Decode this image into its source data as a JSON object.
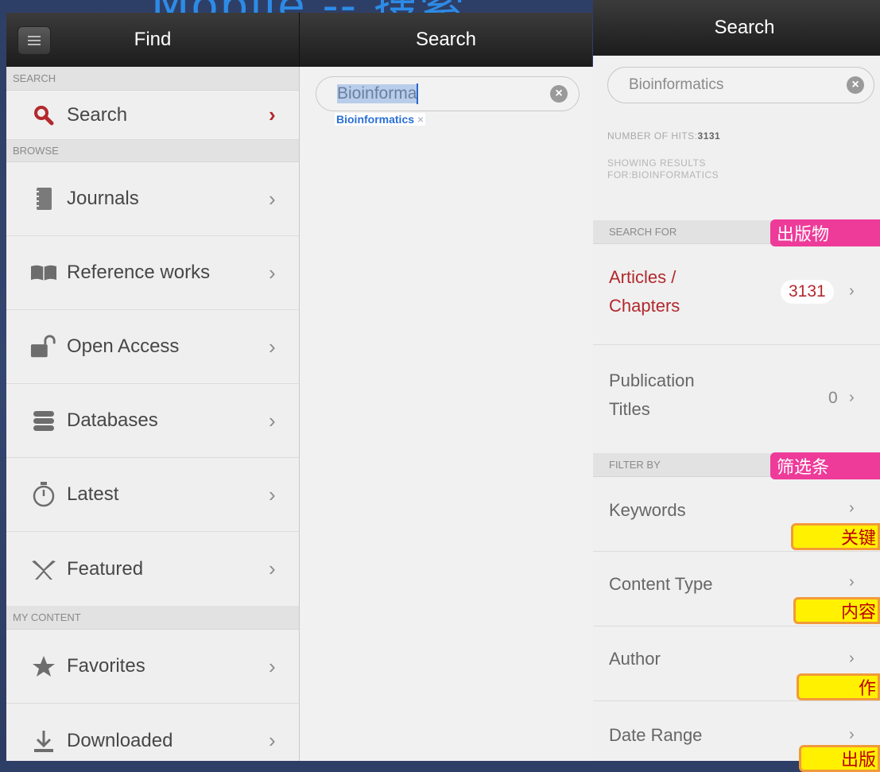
{
  "slide_title": "Mobile -- 搜索",
  "left_panel": {
    "title": "Find",
    "sections": {
      "search": "SEARCH",
      "browse": "BROWSE",
      "my_content": "MY CONTENT"
    },
    "items": [
      {
        "label": "Search",
        "icon": "search-icon"
      },
      {
        "label": "Journals",
        "icon": "journal-icon"
      },
      {
        "label": "Reference works",
        "icon": "book-icon"
      },
      {
        "label": "Open Access",
        "icon": "unlock-icon"
      },
      {
        "label": "Databases",
        "icon": "database-icon"
      },
      {
        "label": "Latest",
        "icon": "timer-icon"
      },
      {
        "label": "Featured",
        "icon": "ribbon-icon"
      },
      {
        "label": "Favorites",
        "icon": "star-icon"
      },
      {
        "label": "Downloaded",
        "icon": "download-icon"
      }
    ]
  },
  "middle_panel": {
    "title": "Search",
    "search_value": "Bioinforma",
    "suggestion": "Bioinformatics"
  },
  "right_panel": {
    "title": "Search",
    "search_value": "Bioinformatics",
    "hits_label": "NUMBER OF HITS:",
    "hits_value": "3131",
    "showing_line1": "SHOWING RESULTS",
    "showing_line2": "FOR:BIOINFORMATICS",
    "search_for_header": "SEARCH FOR",
    "filter_by_header": "FILTER BY",
    "articles_line1": "Articles /",
    "articles_line2": "Chapters",
    "articles_count": "3131",
    "pubs_line1": "Publication",
    "pubs_line2": "Titles",
    "pubs_count": "0",
    "filters": [
      "Keywords",
      "Content Type",
      "Author",
      "Date Range"
    ]
  },
  "annotations": {
    "tag_publications": "出版物",
    "tag_filter": "筛选条",
    "tag_keywords": "关键",
    "tag_content": "内容",
    "tag_author": "作",
    "tag_date": "出版"
  },
  "colors": {
    "accent_red": "#b3282d",
    "annotation_pink": "#ee3b9a",
    "annotation_yellow": "#fff100",
    "title_blue": "#2d8be6"
  }
}
